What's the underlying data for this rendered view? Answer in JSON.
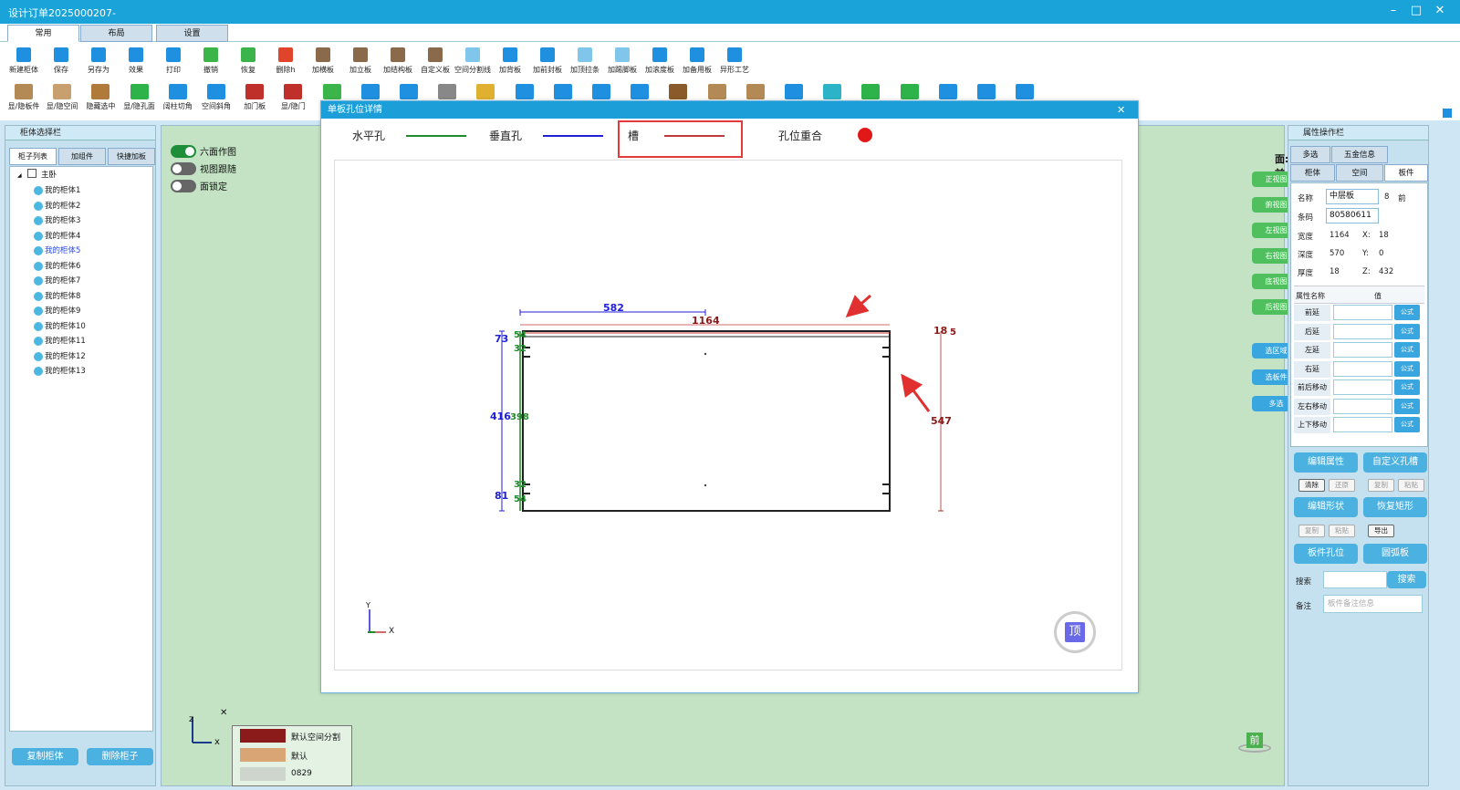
{
  "window": {
    "title": "设计订单2025000207-",
    "minimize": "–",
    "maximize": "□",
    "close": "✕"
  },
  "main_tabs": [
    {
      "label": "常用"
    },
    {
      "label": "布局"
    },
    {
      "label": "设置"
    }
  ],
  "toolbar_row1": [
    {
      "label": "新建柜体",
      "icon": "new-cabinet-icon",
      "color": "#1f8fe0"
    },
    {
      "label": "保存",
      "icon": "save-icon",
      "color": "#1f8fe0"
    },
    {
      "label": "另存为",
      "icon": "save-as-icon",
      "color": "#1f8fe0"
    },
    {
      "label": "效果",
      "icon": "effect-icon",
      "color": "#1f8fe0"
    },
    {
      "label": "打印",
      "icon": "print-icon",
      "color": "#1f8fe0"
    },
    {
      "label": "撤销",
      "icon": "undo-icon",
      "color": "#3bb54a"
    },
    {
      "label": "恢复",
      "icon": "redo-icon",
      "color": "#3bb54a"
    },
    {
      "label": "删除h",
      "icon": "delete-icon",
      "color": "#e0452b"
    },
    {
      "label": "加横板",
      "icon": "horizontal-board-icon",
      "color": "#8a6a4a"
    },
    {
      "label": "加立板",
      "icon": "vertical-board-icon",
      "color": "#8a6a4a"
    },
    {
      "label": "加结构板",
      "icon": "structure-board-icon",
      "color": "#8a6a4a"
    },
    {
      "label": "自定义板",
      "icon": "custom-board-icon",
      "color": "#8a6a4a"
    },
    {
      "label": "空间分割线",
      "icon": "space-divider-icon",
      "color": "#7fc6ea"
    },
    {
      "label": "加背板",
      "icon": "back-board-icon",
      "color": "#1f8fe0"
    },
    {
      "label": "加前封板",
      "icon": "front-cover-icon",
      "color": "#1f8fe0"
    },
    {
      "label": "加顶拉条",
      "icon": "top-strip-icon",
      "color": "#7fc6ea"
    },
    {
      "label": "加踢脚板",
      "icon": "kickboard-icon",
      "color": "#7fc6ea"
    },
    {
      "label": "加滚度板",
      "icon": "roll-board-icon",
      "color": "#1f8fe0"
    },
    {
      "label": "加备用板",
      "icon": "spare-board-icon",
      "color": "#1f8fe0"
    },
    {
      "label": "异形工艺",
      "icon": "shaped-craft-icon",
      "color": "#1f8fe0"
    }
  ],
  "toolbar_row2": [
    {
      "label": "显/隐板件",
      "icon": "toggle-board-icon",
      "color": "#b38a55"
    },
    {
      "label": "显/隐空间",
      "icon": "toggle-space-icon",
      "color": "#c8a070"
    },
    {
      "label": "隐藏选中",
      "icon": "hide-selected-icon",
      "color": "#b07a3a"
    },
    {
      "label": "显/隐孔面",
      "icon": "toggle-hole-face-icon",
      "color": "#2db34a"
    },
    {
      "label": "阔柱切角",
      "icon": "column-chamfer-icon",
      "color": "#1f8fe0"
    },
    {
      "label": "空间斜角",
      "icon": "space-bevel-icon",
      "color": "#1f8fe0"
    },
    {
      "label": "加门板",
      "icon": "door-board-icon",
      "color": "#c0302a"
    },
    {
      "label": "显/隐门",
      "icon": "toggle-door-icon",
      "color": "#c0302a"
    },
    {
      "label": "",
      "icon": "tool-icon-9",
      "color": "#3bb54a"
    },
    {
      "label": "",
      "icon": "tool-icon-10",
      "color": "#1f8fe0"
    },
    {
      "label": "",
      "icon": "tool-icon-11",
      "color": "#1f8fe0"
    },
    {
      "label": "",
      "icon": "tool-icon-12",
      "color": "#888888"
    },
    {
      "label": "",
      "icon": "tool-icon-13",
      "color": "#e0b030"
    },
    {
      "label": "",
      "icon": "tool-icon-14",
      "color": "#1f8fe0"
    },
    {
      "label": "",
      "icon": "tool-icon-15",
      "color": "#1f8fe0"
    },
    {
      "label": "",
      "icon": "tool-icon-16",
      "color": "#1f8fe0"
    },
    {
      "label": "",
      "icon": "tool-icon-17",
      "color": "#1f8fe0"
    },
    {
      "label": "",
      "icon": "tool-icon-18",
      "color": "#8a5a2a"
    },
    {
      "label": "",
      "icon": "tool-icon-19",
      "color": "#b38a55"
    },
    {
      "label": "",
      "icon": "tool-icon-20",
      "color": "#b38a55"
    },
    {
      "label": "",
      "icon": "tool-icon-21",
      "color": "#1f8fe0"
    },
    {
      "label": "",
      "icon": "tool-icon-22",
      "color": "#2db3c8"
    },
    {
      "label": "",
      "icon": "tool-icon-23",
      "color": "#2db34a"
    },
    {
      "label": "",
      "icon": "tool-icon-24",
      "color": "#2db34a"
    },
    {
      "label": "",
      "icon": "tool-icon-25",
      "color": "#1f8fe0"
    },
    {
      "label": "",
      "icon": "tool-icon-26",
      "color": "#1f8fe0"
    },
    {
      "label": "",
      "icon": "tool-icon-27",
      "color": "#1f8fe0"
    }
  ],
  "left_panel": {
    "header": "柜体选择栏",
    "tabs": [
      {
        "label": "柜子列表"
      },
      {
        "label": "加组件"
      },
      {
        "label": "快捷加板"
      }
    ],
    "root": "主卧",
    "expand": "◢",
    "items": [
      {
        "label": "我的柜体1"
      },
      {
        "label": "我的柜体2"
      },
      {
        "label": "我的柜体3"
      },
      {
        "label": "我的柜体4"
      },
      {
        "label": "我的柜体5"
      },
      {
        "label": "我的柜体6"
      },
      {
        "label": "我的柜体7"
      },
      {
        "label": "我的柜体8"
      },
      {
        "label": "我的柜体9"
      },
      {
        "label": "我的柜体10"
      },
      {
        "label": "我的柜体11"
      },
      {
        "label": "我的柜体12"
      },
      {
        "label": "我的柜体13"
      }
    ],
    "copy_button": "复制柜体",
    "delete_button": "删除柜子"
  },
  "canvas": {
    "toggles": [
      {
        "label": "六面作图",
        "on": true
      },
      {
        "label": "视图跟随",
        "on": false
      },
      {
        "label": "面锁定",
        "on": false
      }
    ],
    "face_label": "面:前",
    "view_buttons": [
      "正视图",
      "俯视图",
      "左视图",
      "右视图",
      "底视图",
      "后视图"
    ],
    "select_buttons": [
      "选区域",
      "选板件",
      "多选"
    ],
    "axis_x": "x",
    "axis_z": "z",
    "axis_close": "✕",
    "front_badge": "前",
    "color_legend": [
      {
        "label": "默认空间分割",
        "color": "#8b1a1a"
      },
      {
        "label": "默认",
        "color": "#d9a574"
      },
      {
        "label": "0829",
        "color": "#cdd5cd"
      }
    ]
  },
  "dialog": {
    "title": "单板孔位详情",
    "close": "✕",
    "legend": [
      {
        "label": "水平孔",
        "color": "#1e8c2a"
      },
      {
        "label": "垂直孔",
        "color": "#2020d8"
      },
      {
        "label": "槽",
        "color": "#c03a3a"
      },
      {
        "label": "孔位重合",
        "color": "#e01818"
      }
    ],
    "dims": {
      "half_width": "582",
      "width": "1164",
      "left_total": "416",
      "top_offset": "73",
      "bottom_offset": "81",
      "hole_a": "54",
      "hole_b": "32",
      "middle": "398",
      "hole_c": "32",
      "hole_d": "54",
      "thickness": "18",
      "slot_offset": "5",
      "depth": "547"
    },
    "axis_y": "Y",
    "axis_x": "X",
    "top_badge": "顶"
  },
  "right_panel": {
    "header": "属性操作栏",
    "tabs_row1": [
      {
        "label": "多选"
      },
      {
        "label": "五金信息"
      }
    ],
    "tabs_row2": [
      {
        "label": "柜体"
      },
      {
        "label": "空间"
      },
      {
        "label": "板件"
      }
    ],
    "name_label": "名称",
    "name_value": "中层板",
    "name_num": "8",
    "name_face": "前",
    "code_label": "条码",
    "code_value": "80580611",
    "width_label": "宽度",
    "width_value": "1164",
    "x_label": "X:",
    "x_value": "18",
    "depth_label": "深度",
    "depth_value": "570",
    "y_label": "Y:",
    "y_value": "0",
    "thick_label": "厚度",
    "thick_value": "18",
    "z_label": "Z:",
    "z_value": "432",
    "table_head_name": "属性名称",
    "table_head_value": "值",
    "props": [
      {
        "label": "前延"
      },
      {
        "label": "后延"
      },
      {
        "label": "左延"
      },
      {
        "label": "右延"
      },
      {
        "label": "前后移动"
      },
      {
        "label": "左右移动"
      },
      {
        "label": "上下移动"
      }
    ],
    "formula": "公式",
    "edit_attr": "编辑属性",
    "custom_hole": "自定义孔槽",
    "small1": [
      "清除",
      "还原",
      "复制",
      "粘贴"
    ],
    "edit_shape": "编辑形状",
    "restore_rect": "恢复矩形",
    "small2": [
      "复制",
      "粘贴",
      "导出"
    ],
    "board_hole": "板件孔位",
    "arc_board": "圆弧板",
    "search_label": "搜索",
    "search_button": "搜索",
    "note_label": "备注",
    "note_placeholder": "板件备注信息"
  }
}
